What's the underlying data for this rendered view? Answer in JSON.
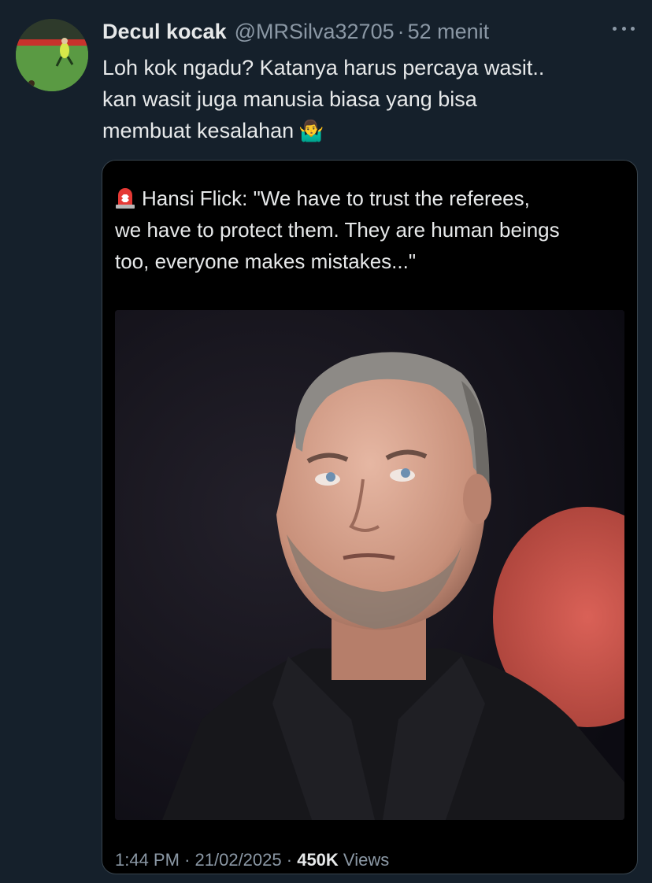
{
  "author": {
    "display_name": "Decul kocak",
    "handle": "@MRSilva32705",
    "separator": "·",
    "time_ago": "52 menit"
  },
  "tweet": {
    "lines": [
      "Loh kok ngadu? Katanya harus percaya wasit..",
      "kan wasit juga manusia biasa yang bisa",
      "membuat kesalahan"
    ],
    "emoji": "🤷‍♂️"
  },
  "media": {
    "quote_lines": [
      "Hansi Flick: \"We have to trust the referees,",
      "we have to protect them. They are human beings",
      "too, everyone makes mistakes...\""
    ],
    "siren_icon": "siren-icon",
    "photo_icon": "portrait-photo"
  },
  "meta": {
    "time": "1:44 PM",
    "separator": "·",
    "date": "21/02/2025",
    "views_count": "450K",
    "views_label": "Views"
  },
  "colors": {
    "background": "#15202b",
    "text": "#e7e9ea",
    "muted": "#8b98a5",
    "border": "#38444d"
  }
}
